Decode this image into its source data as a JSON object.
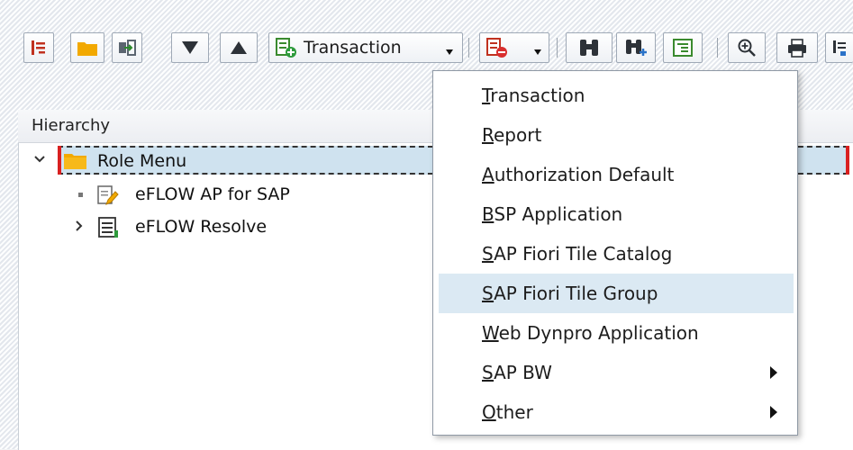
{
  "toolbar": {
    "transaction_label": "Transaction"
  },
  "hierarchy": {
    "header": "Hierarchy",
    "root_label": "Role Menu",
    "children": [
      {
        "label": "eFLOW AP for SAP"
      },
      {
        "label": "eFLOW Resolve"
      }
    ]
  },
  "menu": {
    "items": [
      {
        "first": "T",
        "rest": "ransaction",
        "highlighted": false,
        "submenu": false
      },
      {
        "first": "R",
        "rest": "eport",
        "highlighted": false,
        "submenu": false
      },
      {
        "first": "A",
        "rest": "uthorization Default",
        "highlighted": false,
        "submenu": false
      },
      {
        "first": "B",
        "rest": "SP Application",
        "highlighted": false,
        "submenu": false
      },
      {
        "first": "S",
        "rest": "AP Fiori Tile Catalog",
        "highlighted": false,
        "submenu": false
      },
      {
        "first": "S",
        "rest": "AP Fiori Tile Group",
        "highlighted": true,
        "submenu": false
      },
      {
        "first": "W",
        "rest": "eb Dynpro Application",
        "highlighted": false,
        "submenu": false
      },
      {
        "first": "S",
        "rest": "AP BW",
        "highlighted": false,
        "submenu": true
      },
      {
        "first": "O",
        "rest": "ther",
        "highlighted": false,
        "submenu": true
      }
    ]
  },
  "colors": {
    "selection": "#cfe2ef",
    "menu_highlight": "#dbe9f3",
    "folder": "#f2a900"
  }
}
